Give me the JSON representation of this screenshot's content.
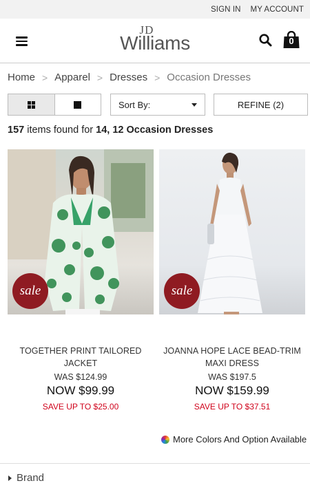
{
  "topbar": {
    "sign_in": "SIGN IN",
    "my_account": "MY ACCOUNT"
  },
  "header": {
    "logo_line1": "JD",
    "logo_line2": "Williams",
    "bag_count": "0",
    "icons": [
      "menu-icon",
      "search-icon",
      "shopping-bag-icon"
    ]
  },
  "breadcrumb": [
    "Home",
    "Apparel",
    "Dresses",
    "Occasion Dresses"
  ],
  "breadcrumb_separator": ">",
  "controls": {
    "sort_label": "Sort By:",
    "refine_label": "REFINE (2)",
    "view_modes": [
      "grid-view-icon",
      "single-view-icon"
    ]
  },
  "results": {
    "count": "157",
    "text": " items found for ",
    "query": "14, 12 Occasion Dresses"
  },
  "products": [
    {
      "name": "TOGETHER PRINT TAILORED JACKET",
      "badge": "sale",
      "was": "WAS $124.99",
      "now": "NOW $99.99",
      "save": "SAVE UP TO $25.00"
    },
    {
      "name": "JOANNA HOPE LACE BEAD-TRIM MAXI DRESS",
      "badge": "sale",
      "was": "WAS $197.5",
      "now": "NOW $159.99",
      "save": "SAVE UP TO $37.51"
    }
  ],
  "colors_note": "More Colors And Option Available",
  "filter": {
    "brand": "Brand"
  },
  "colors": {
    "sale_badge": "#8f1b22",
    "save_text": "#d0021b"
  }
}
